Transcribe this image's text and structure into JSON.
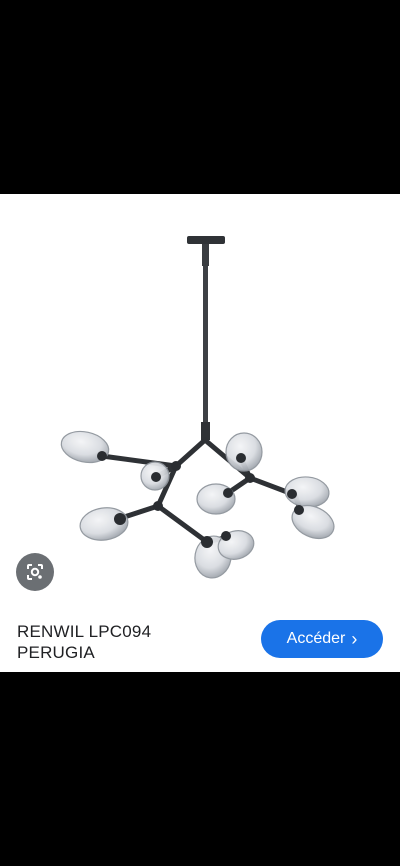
{
  "result": {
    "title": "RENWIL LPC094 PERUGIA",
    "title_line1": "RENWIL LPC094",
    "title_line2": "PERUGIA",
    "visit_label": "Accéder",
    "visit_chevron": "›"
  },
  "icons": {
    "lens": "google-lens-icon",
    "chevron": "chevron-right-icon"
  },
  "colors": {
    "accent": "#1a73e8",
    "lens_bg": "#5f6368",
    "text": "#202124"
  }
}
